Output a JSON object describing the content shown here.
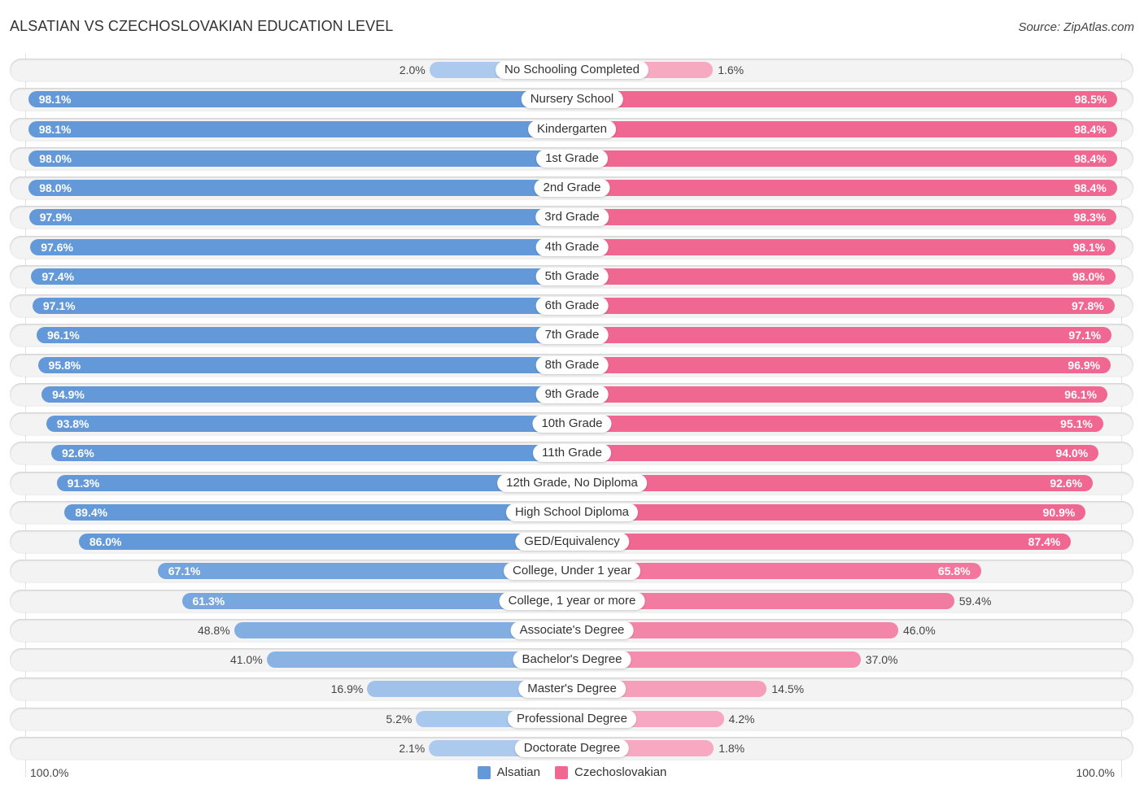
{
  "header": {
    "title": "ALSATIAN VS CZECHOSLOVAKIAN EDUCATION LEVEL",
    "source": "Source: ZipAtlas.com"
  },
  "axis": {
    "left_label": "100.0%",
    "right_label": "100.0%"
  },
  "legend": [
    {
      "name": "Alsatian",
      "color": "#6399d9"
    },
    {
      "name": "Czechoslovakian",
      "color": "#f06792"
    }
  ],
  "colors": {
    "left_strong": "#6399d9",
    "left_light": "#aecbee",
    "right_strong": "#f06792",
    "right_light": "#f7aac3"
  },
  "chart_data": {
    "type": "bar",
    "orientation": "horizontal-diverging",
    "title": "ALSATIAN VS CZECHOSLOVAKIAN EDUCATION LEVEL",
    "xlabel": "",
    "ylabel": "",
    "xlim": [
      0,
      100
    ],
    "legend_position": "bottom",
    "categories": [
      "No Schooling Completed",
      "Nursery School",
      "Kindergarten",
      "1st Grade",
      "2nd Grade",
      "3rd Grade",
      "4th Grade",
      "5th Grade",
      "6th Grade",
      "7th Grade",
      "8th Grade",
      "9th Grade",
      "10th Grade",
      "11th Grade",
      "12th Grade, No Diploma",
      "High School Diploma",
      "GED/Equivalency",
      "College, Under 1 year",
      "College, 1 year or more",
      "Associate's Degree",
      "Bachelor's Degree",
      "Master's Degree",
      "Professional Degree",
      "Doctorate Degree"
    ],
    "series": [
      {
        "name": "Alsatian",
        "side": "left",
        "values": [
          2.0,
          98.1,
          98.1,
          98.0,
          98.0,
          97.9,
          97.6,
          97.4,
          97.1,
          96.1,
          95.8,
          94.9,
          93.8,
          92.6,
          91.3,
          89.4,
          86.0,
          67.1,
          61.3,
          48.8,
          41.0,
          16.9,
          5.2,
          2.1
        ]
      },
      {
        "name": "Czechoslovakian",
        "side": "right",
        "values": [
          1.6,
          98.5,
          98.4,
          98.4,
          98.4,
          98.3,
          98.1,
          98.0,
          97.8,
          97.1,
          96.9,
          96.1,
          95.1,
          94.0,
          92.6,
          90.9,
          87.4,
          65.8,
          59.4,
          46.0,
          37.0,
          14.5,
          4.2,
          1.8
        ]
      }
    ],
    "value_suffix": "%"
  }
}
